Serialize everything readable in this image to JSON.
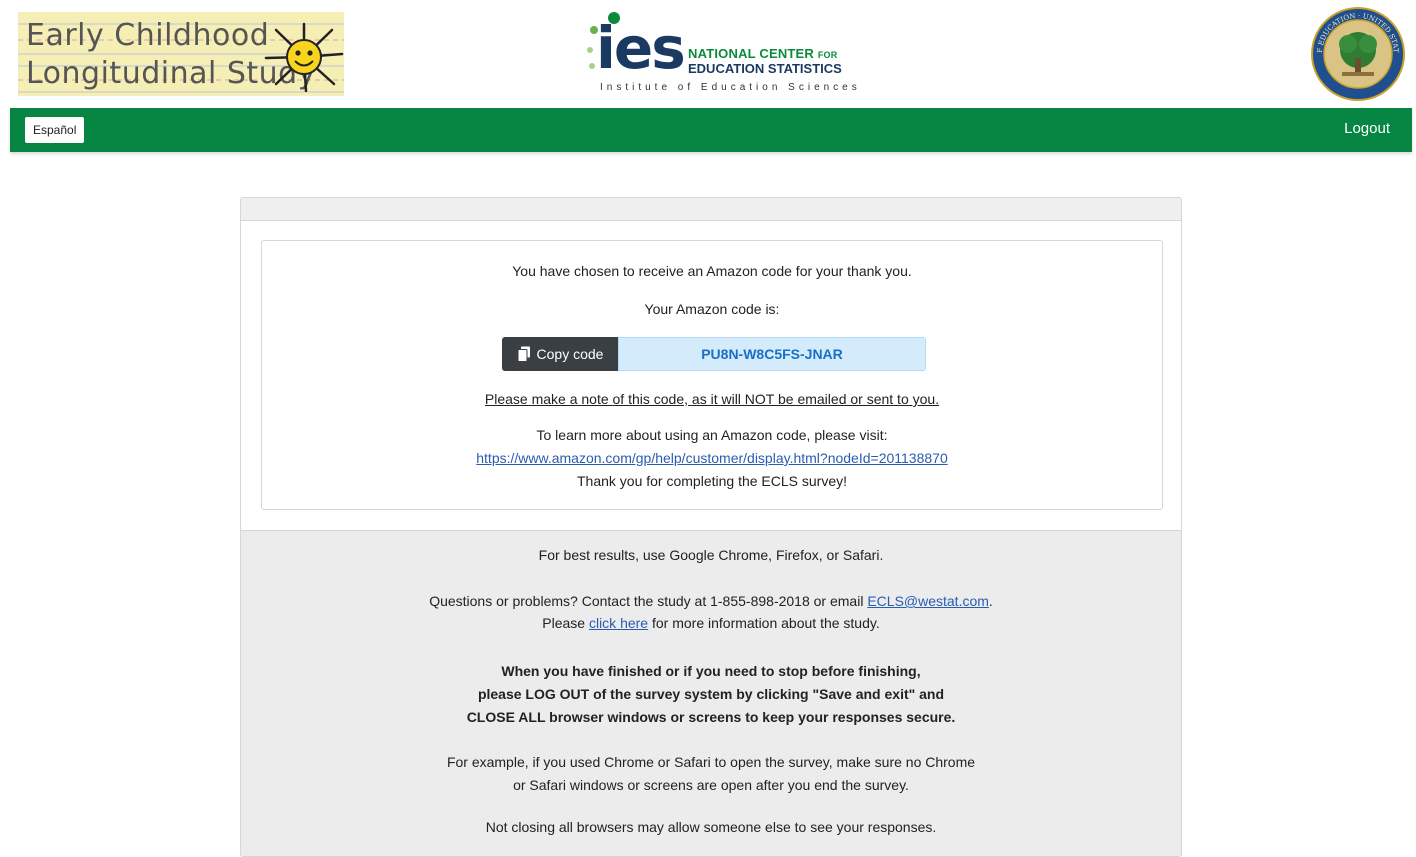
{
  "header": {
    "ecls_logo": {
      "line1": "Early Childhood",
      "line2": "Longitudinal Study"
    },
    "ies_logo": {
      "ies": "ies",
      "nces_line1": "NATIONAL CENTER",
      "nces_for": "FOR",
      "nces_line2": "EDUCATION STATISTICS",
      "institute": "Institute of Education Sciences"
    },
    "seal": {
      "text": "DEPARTMENT OF EDUCATION · UNITED STATES OF AMERICA"
    }
  },
  "navbar": {
    "language_button": "Español",
    "logout_label": "Logout",
    "color": "#078542"
  },
  "main": {
    "line1": "You have chosen to receive an Amazon code for your thank you.",
    "line2": "Your Amazon code is:",
    "copy_button": "Copy code",
    "code": "PU8N-W8C5FS-JNAR",
    "note": "Please make a note of this code, as it will NOT be emailed or sent to you.",
    "learn_more": "To learn more about using an Amazon code, please visit:",
    "amazon_link": "https://www.amazon.com/gp/help/customer/display.html?nodeId=201138870",
    "thanks": "Thank you for completing the ECLS survey!"
  },
  "footer": {
    "browsers": "For best results, use Google Chrome, Firefox, or Safari.",
    "questions_prefix": "Questions or problems? Contact the study at 1-855-898-2018 or email ",
    "email": "ECLS@westat.com",
    "questions_suffix": ".",
    "please": "Please ",
    "click_here": "click here",
    "more_info": " for more information about the study.",
    "bold_line1": "When you have finished or if you need to stop before finishing,",
    "bold_line2": "please LOG OUT of the survey system by clicking \"Save and exit\" and",
    "bold_line3": "CLOSE ALL browser windows or screens to keep your responses secure.",
    "example_line1": "For example, if you used Chrome or Safari to open the survey, make sure no Chrome",
    "example_line2": "or Safari windows or screens are open after you end the survey.",
    "warning": "Not closing all browsers may allow someone else to see your responses."
  }
}
